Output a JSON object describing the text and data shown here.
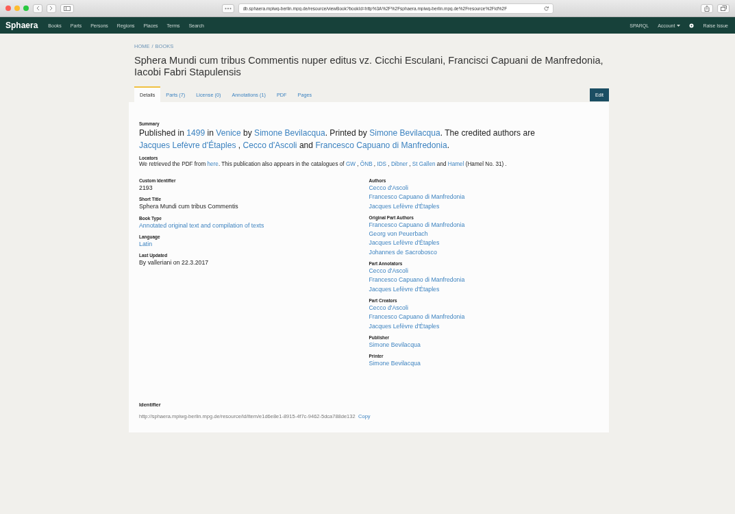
{
  "browser": {
    "address": "db.sphaera.mpiwg-berlin.mpg.de/resource/viewBook?bookId=http%3A%2F%2Fsphaera.mpiwg-berlin.mpg.de%2Fresource%2Fid%2F"
  },
  "navbar": {
    "brand": "Sphaera",
    "items": [
      "Books",
      "Parts",
      "Persons",
      "Regions",
      "Places",
      "Terms",
      "Search"
    ],
    "right": [
      {
        "kind": "link",
        "label": "SPARQL"
      },
      {
        "kind": "dropdown",
        "label": "Account"
      },
      {
        "kind": "icon-link",
        "label": "Raise Issue"
      }
    ]
  },
  "breadcrumb": {
    "items": [
      "HOME",
      "BOOKS"
    ],
    "separator": "/"
  },
  "title": "Sphera Mundi cum tribus Commentis nuper editus vz. Cicchi Esculani, Francisci Capuani de Manfredonia, Iacobi Fabri Stapulensis",
  "tabs": [
    {
      "label": "Details",
      "selected": true
    },
    {
      "label": "Parts (7)",
      "selected": false
    },
    {
      "label": "License (0)",
      "selected": false
    },
    {
      "label": "Annotations (1)",
      "selected": false
    },
    {
      "label": "PDF",
      "selected": false
    },
    {
      "label": "Pages",
      "selected": false
    }
  ],
  "edit_button": "Edit",
  "summary": {
    "label": "Summary",
    "segments": [
      {
        "kind": "text",
        "text": "Published in "
      },
      {
        "kind": "link",
        "text": "1499"
      },
      {
        "kind": "text",
        "text": " in "
      },
      {
        "kind": "link",
        "text": "Venice"
      },
      {
        "kind": "text",
        "text": " by "
      },
      {
        "kind": "link",
        "text": "Simone Bevilacqua"
      },
      {
        "kind": "text",
        "text": ". Printed by "
      },
      {
        "kind": "link",
        "text": "Simone Bevilacqua"
      },
      {
        "kind": "text",
        "text": ". The credited authors are "
      },
      {
        "kind": "link",
        "text": "Jacques Lefèvre d'Étaples"
      },
      {
        "kind": "text",
        "text": " , "
      },
      {
        "kind": "link",
        "text": "Cecco d'Ascoli"
      },
      {
        "kind": "text",
        "text": " and "
      },
      {
        "kind": "link",
        "text": "Francesco Capuano di Manfredonia"
      },
      {
        "kind": "text",
        "text": "."
      }
    ]
  },
  "locators": {
    "label": "Locators",
    "segments": [
      {
        "kind": "text",
        "text": "We retrieved the PDF from "
      },
      {
        "kind": "link",
        "text": "here"
      },
      {
        "kind": "text",
        "text": ". This publication also appears in the catalogues of "
      },
      {
        "kind": "link",
        "text": "GW"
      },
      {
        "kind": "text",
        "text": " , "
      },
      {
        "kind": "link",
        "text": "ÖNB"
      },
      {
        "kind": "text",
        "text": " , "
      },
      {
        "kind": "link",
        "text": "IDS"
      },
      {
        "kind": "text",
        "text": " , "
      },
      {
        "kind": "link",
        "text": "Dibner"
      },
      {
        "kind": "text",
        "text": " , "
      },
      {
        "kind": "link",
        "text": "St Gallen"
      },
      {
        "kind": "text",
        "text": " and "
      },
      {
        "kind": "link",
        "text": "Hamel"
      },
      {
        "kind": "text",
        "text": " (Hamel No. 31) ."
      }
    ]
  },
  "details_left": [
    {
      "label": "Custom Identifier",
      "values": [
        {
          "kind": "text",
          "text": "2193"
        }
      ]
    },
    {
      "label": "Short Title",
      "values": [
        {
          "kind": "text",
          "text": "Sphera Mundi cum tribus Commentis"
        }
      ]
    },
    {
      "label": "Book Type",
      "values": [
        {
          "kind": "link",
          "text": "Annotated original text and compilation of texts"
        }
      ]
    },
    {
      "label": "Language",
      "values": [
        {
          "kind": "link",
          "text": "Latin"
        }
      ]
    },
    {
      "label": "Last Updated",
      "values": [
        {
          "kind": "text",
          "text": "By valleriani on 22.3.2017"
        }
      ]
    }
  ],
  "details_right": [
    {
      "label": "Authors",
      "values": [
        {
          "kind": "link",
          "text": "Cecco d'Ascoli"
        },
        {
          "kind": "link",
          "text": "Francesco Capuano di Manfredonia"
        },
        {
          "kind": "link",
          "text": "Jacques Lefèvre d'Étaples"
        }
      ]
    },
    {
      "label": "Original Part Authors",
      "values": [
        {
          "kind": "link",
          "text": "Francesco Capuano di Manfredonia"
        },
        {
          "kind": "link",
          "text": "Georg von Peuerbach"
        },
        {
          "kind": "link",
          "text": "Jacques Lefèvre d'Étaples"
        },
        {
          "kind": "link",
          "text": "Johannes de Sacrobosco"
        }
      ]
    },
    {
      "label": "Part Annotators",
      "values": [
        {
          "kind": "link",
          "text": "Cecco d'Ascoli"
        },
        {
          "kind": "link",
          "text": "Francesco Capuano di Manfredonia"
        },
        {
          "kind": "link",
          "text": "Jacques Lefèvre d'Étaples"
        }
      ]
    },
    {
      "label": "Part Creators",
      "values": [
        {
          "kind": "link",
          "text": "Cecco d'Ascoli"
        },
        {
          "kind": "link",
          "text": "Francesco Capuano di Manfredonia"
        },
        {
          "kind": "link",
          "text": "Jacques Lefèvre d'Étaples"
        }
      ]
    },
    {
      "label": "Publisher",
      "values": [
        {
          "kind": "link",
          "text": "Simone Bevilacqua"
        }
      ]
    },
    {
      "label": "Printer",
      "values": [
        {
          "kind": "link",
          "text": "Simone Bevilacqua"
        }
      ]
    }
  ],
  "identifier": {
    "label": "Identifier",
    "value": "http://sphaera.mpiwg-berlin.mpg.de/resource/id/item/e1d6e8e1-8915-4f7c-9462-5dca788de132",
    "copy": "Copy"
  }
}
